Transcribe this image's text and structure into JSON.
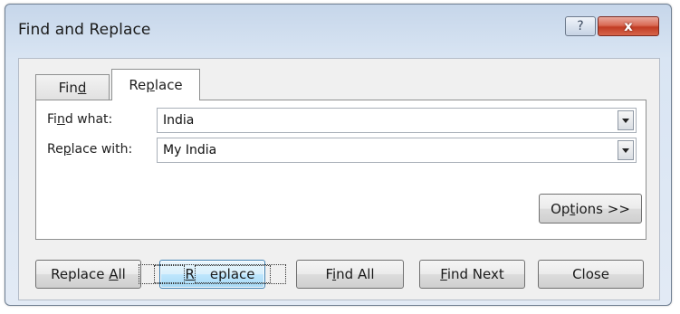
{
  "window": {
    "title": "Find and Replace",
    "help_icon": "?",
    "close_icon": "x"
  },
  "tabs": [
    {
      "label_pre": "Fin",
      "label_accel": "d",
      "label_post": "",
      "selected": false
    },
    {
      "label_pre": "Re",
      "label_accel": "p",
      "label_post": "lace",
      "selected": true
    }
  ],
  "find_what": {
    "label_pre": "Fi",
    "label_accel": "n",
    "label_post": "d what:",
    "value": "India"
  },
  "replace_with": {
    "label_pre": "Re",
    "label_accel": "p",
    "label_post": "lace with:",
    "value": "My India"
  },
  "buttons": {
    "options": {
      "pre": "Op",
      "accel": "t",
      "post": "ions >>"
    },
    "replace_all": {
      "pre": "Replace ",
      "accel": "A",
      "post": "ll"
    },
    "replace": {
      "pre": "",
      "accel": "R",
      "post": "eplace"
    },
    "find_all": {
      "pre": "F",
      "accel": "i",
      "post": "nd All"
    },
    "find_next": {
      "pre": "",
      "accel": "F",
      "post": "ind Next"
    },
    "close": {
      "label": "Close"
    }
  },
  "colors": {
    "title_bar": "#c6d6ea",
    "close_button": "#c13c24",
    "default_button_border": "#3c7fb1"
  }
}
